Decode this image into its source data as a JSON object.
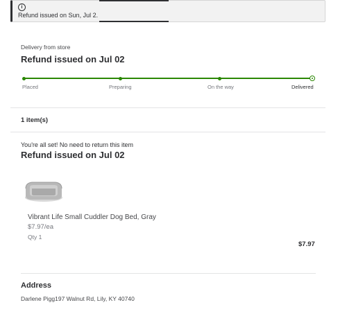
{
  "alert": {
    "icon": "info-icon",
    "text": "Refund issued on Sun, Jul 2."
  },
  "delivery": {
    "label": "Delivery from store",
    "title": "Refund issued on Jul 02",
    "steps": [
      "Placed",
      "Preparing",
      "On the way",
      "Delivered"
    ],
    "progress_color": "#2a8703"
  },
  "items": {
    "count_label": "1 item(s)",
    "return_note": "You're all set! No need to return this item",
    "title": "Refund issued on Jul 02",
    "product": {
      "image": "dog-bed-image",
      "name": "Vibrant Life Small Cuddler Dog Bed, Gray",
      "unit_price": "$7.97/ea",
      "qty": "Qty 1",
      "total": "$7.97"
    }
  },
  "address": {
    "heading": "Address",
    "line": "Darlene Pigg197 Walnut Rd, Lily, KY 40740"
  }
}
